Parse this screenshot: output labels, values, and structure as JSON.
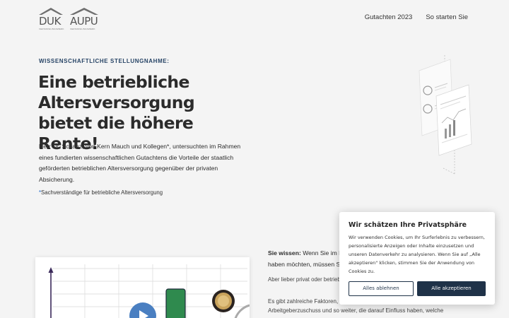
{
  "header": {
    "logos": [
      {
        "mark": "DUK",
        "tagline": "VERSORGUNGSWERK"
      },
      {
        "mark": "AUPU",
        "tagline": "VERSORGUNGSWERK"
      }
    ],
    "nav": [
      "Gutachten 2023",
      "So starten Sie"
    ]
  },
  "hero": {
    "eyebrow": "WISSENSCHAFTLICHE STELLUNGNAHME:",
    "headline": "Eine betriebliche Altersversorgung bietet die höhere Rente!",
    "lead": "Herr Dr. Schanz, von Kern Mauch und Kollegen*, untersuchten im Rahmen eines fundierten wissenschaftlichen Gutachtens die Vorteile der staatlich geförderten betrieblichen Altersversorgung gegenüber der privaten Absicherung.",
    "footnote_star": "*",
    "footnote": "Sachverständige für betriebliche Altersversorgung"
  },
  "content": {
    "know_bold": "Sie wissen:",
    "know_rest": " Wenn Sie im R haben möchten, müssen S",
    "aber": "Aber lieber privat oder betrieb",
    "faktoren_1": "Es gibt zahlreiche Faktoren, w",
    "faktoren_2": "Arbeitgeberzuschuss und so weiter, die darauf Einfluss haben, welche"
  },
  "cookie": {
    "title": "Wir schätzen Ihre Privatsphäre",
    "text": "Wir verwenden Cookies, um Ihr Surferlebnis zu verbessern, personalisierte Anzeigen oder Inhalte einzusetzen und unseren Datenverkehr zu analysieren. Wenn Sie auf „Alle akzeptieren\" klicken, stimmen Sie der Anwendung von Cookies zu.",
    "reject": "Alles ablehnen",
    "accept": "Alle akzeptieren"
  },
  "colors": {
    "accent": "#274466",
    "button_dark": "#1f3248",
    "bar_green": "#2f8a4e",
    "play_blue": "#4a7fc1"
  }
}
